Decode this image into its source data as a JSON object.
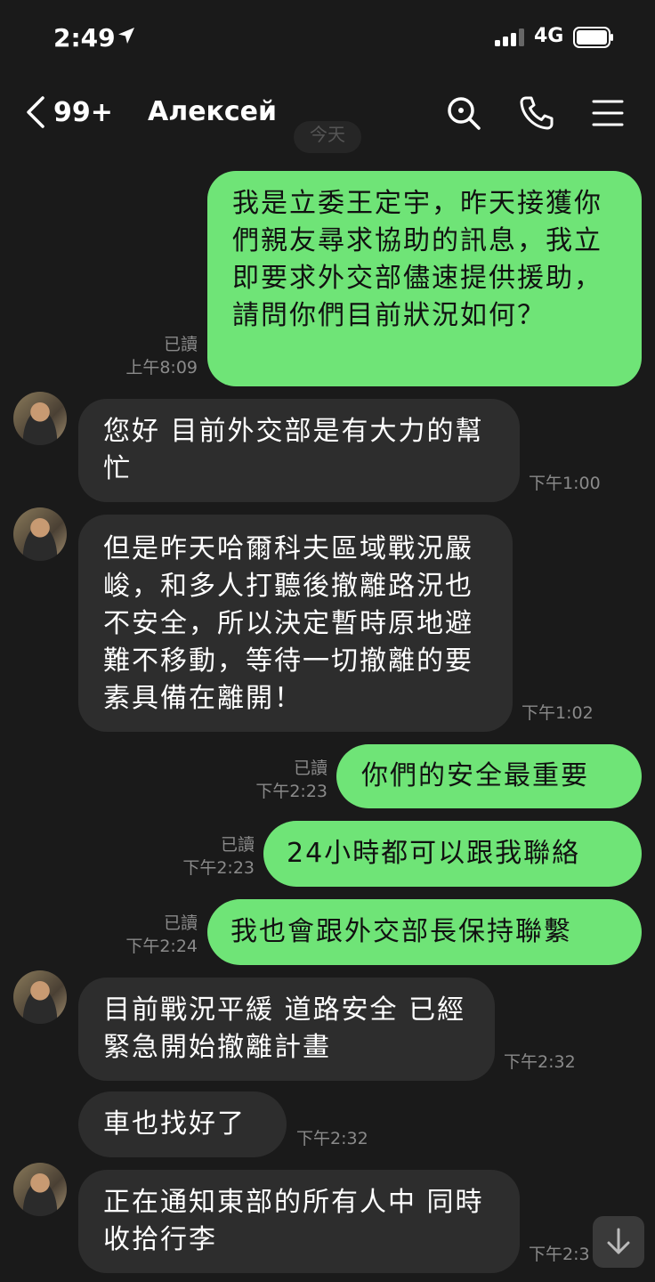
{
  "status": {
    "time": "2:49",
    "network": "4G"
  },
  "header": {
    "back_count": "99+",
    "contact_name": "Алексей"
  },
  "date_label": "今天",
  "messages": [
    {
      "side": "out",
      "text": "我是立委王定宇，昨天接獲你們親友尋求協助的訊息，我立即要求外交部儘速提供援助，請問你們目前狀況如何？",
      "read": "已讀",
      "time": "上午8:09"
    },
    {
      "side": "in",
      "text": "您好 目前外交部是有大力的幫忙",
      "time": "下午1:00"
    },
    {
      "side": "in",
      "text": "但是昨天哈爾科夫區域戰況嚴峻，和多人打聽後撤離路況也不安全，所以決定暫時原地避難不移動，等待一切撤離的要素具備在離開！",
      "time": "下午1:02"
    },
    {
      "side": "out",
      "text": "你們的安全最重要",
      "read": "已讀",
      "time": "下午2:23"
    },
    {
      "side": "out",
      "text": "24小時都可以跟我聯絡",
      "read": "已讀",
      "time": "下午2:23"
    },
    {
      "side": "out",
      "text": "我也會跟外交部長保持聯繫",
      "read": "已讀",
      "time": "下午2:24"
    },
    {
      "side": "in",
      "text": "目前戰況平緩 道路安全 已經緊急開始撤離計畫",
      "time": "下午2:32"
    },
    {
      "side": "in",
      "text": "車也找好了",
      "time": "下午2:32"
    },
    {
      "side": "in",
      "text": "正在通知東部的所有人中 同時收拾行李",
      "time": "下午2:3"
    }
  ],
  "icons": {
    "back": "chevron-left-icon",
    "search": "search-icon",
    "call": "phone-icon",
    "menu": "menu-icon",
    "scroll": "arrow-down-icon"
  },
  "colors": {
    "outgoing_bubble": "#6fe477",
    "incoming_bubble": "#2d2d2d",
    "background": "#1a1a1a"
  }
}
